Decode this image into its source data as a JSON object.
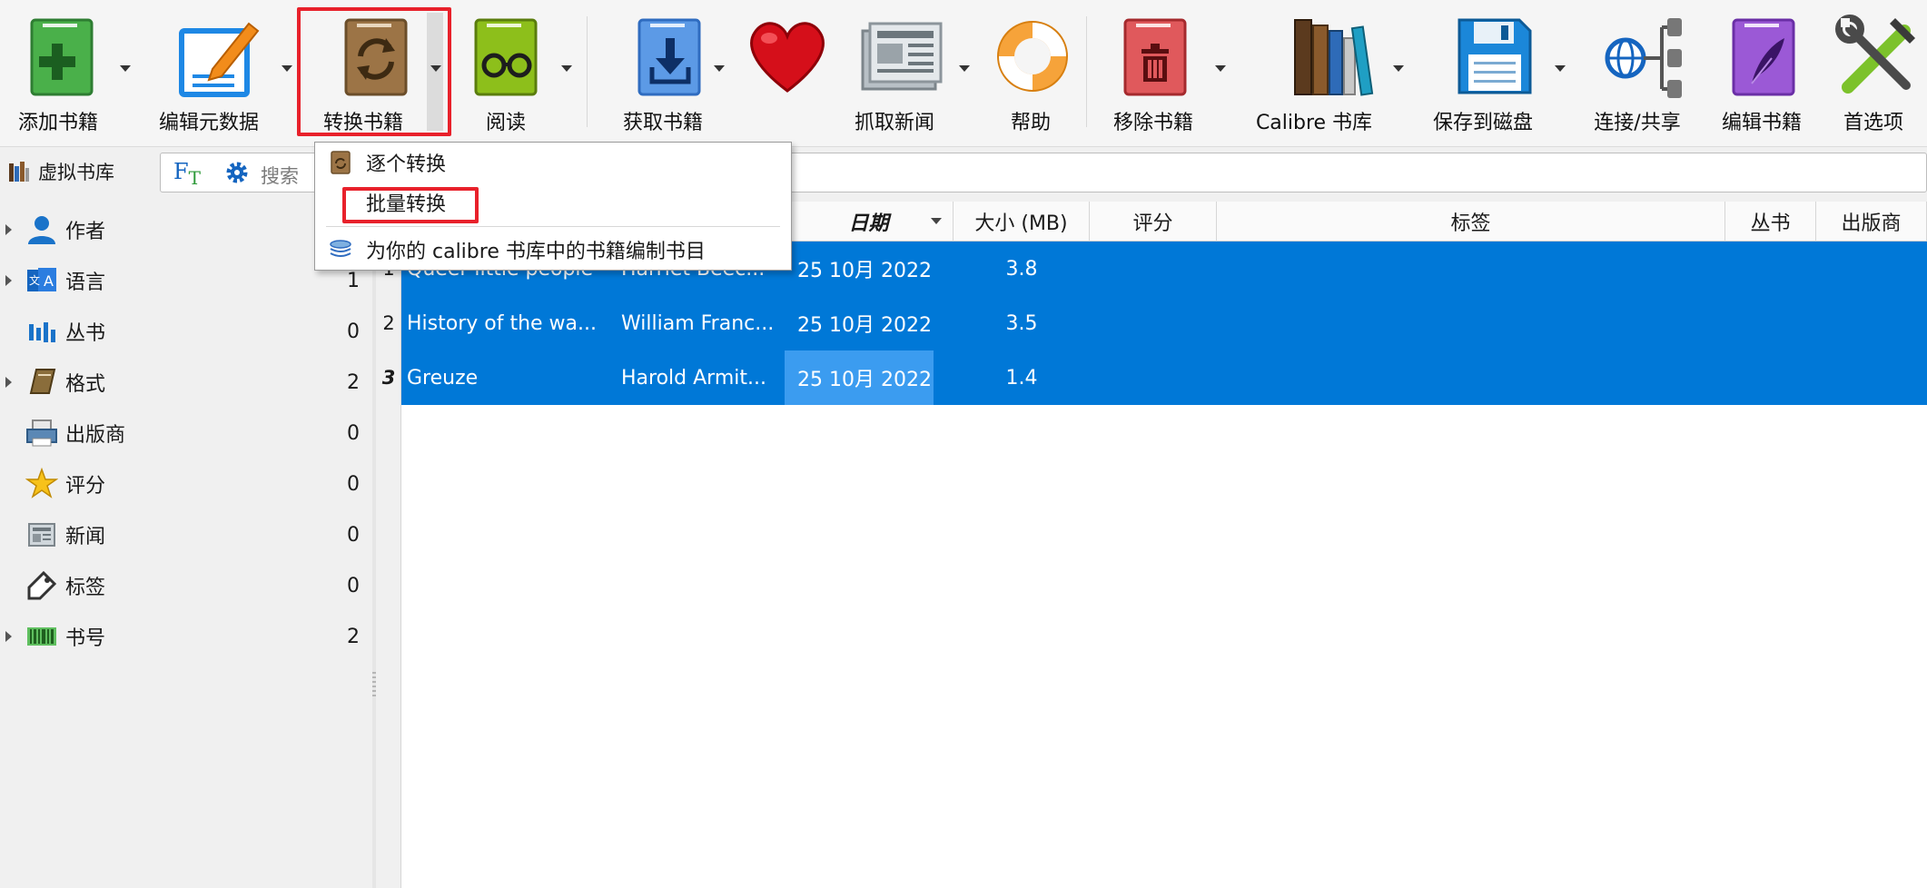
{
  "toolbar": {
    "buttons": [
      {
        "id": "add",
        "label": "添加书籍",
        "icon": "add-book-icon"
      },
      {
        "id": "edit-meta",
        "label": "编辑元数据",
        "icon": "edit-metadata-icon"
      },
      {
        "id": "convert",
        "label": "转换书籍",
        "icon": "convert-book-icon"
      },
      {
        "id": "view",
        "label": "阅读",
        "icon": "read-book-icon"
      },
      {
        "id": "get",
        "label": "获取书籍",
        "icon": "download-book-icon"
      },
      {
        "id": "donate",
        "label": "",
        "icon": "heart-icon"
      },
      {
        "id": "news",
        "label": "抓取新闻",
        "icon": "newspaper-icon"
      },
      {
        "id": "help",
        "label": "帮助",
        "icon": "lifebuoy-icon"
      },
      {
        "id": "remove",
        "label": "移除书籍",
        "icon": "trash-book-icon"
      },
      {
        "id": "library",
        "label": "Calibre 书库",
        "icon": "library-icon"
      },
      {
        "id": "save",
        "label": "保存到磁盘",
        "icon": "floppy-disk-icon"
      },
      {
        "id": "connect",
        "label": "连接/共享",
        "icon": "network-icon"
      },
      {
        "id": "edit-book",
        "label": "编辑书籍",
        "icon": "edit-book-icon"
      },
      {
        "id": "prefs",
        "label": "首选项",
        "icon": "tools-icon"
      }
    ]
  },
  "search": {
    "virtual_library": "虚拟书库",
    "ft_label": "FT",
    "placeholder": "搜索"
  },
  "menu": {
    "items": [
      {
        "label": "逐个转换"
      },
      {
        "label": "批量转换"
      },
      {
        "label": "为你的 calibre 书库中的书籍编制书目"
      }
    ]
  },
  "tag_browser": {
    "items": [
      {
        "name": "作者",
        "count": "",
        "expandable": true,
        "icon": "person-icon"
      },
      {
        "name": "语言",
        "count": "1",
        "expandable": true,
        "icon": "language-icon"
      },
      {
        "name": "丛书",
        "count": "0",
        "expandable": false,
        "icon": "series-icon"
      },
      {
        "name": "格式",
        "count": "2",
        "expandable": true,
        "icon": "format-book-icon"
      },
      {
        "name": "出版商",
        "count": "0",
        "expandable": false,
        "icon": "publisher-icon"
      },
      {
        "name": "评分",
        "count": "0",
        "expandable": false,
        "icon": "star-icon"
      },
      {
        "name": "新闻",
        "count": "0",
        "expandable": false,
        "icon": "news-icon"
      },
      {
        "name": "标签",
        "count": "0",
        "expandable": false,
        "icon": "tag-icon"
      },
      {
        "name": "书号",
        "count": "2",
        "expandable": true,
        "icon": "barcode-icon"
      }
    ]
  },
  "book_table": {
    "columns": {
      "date": "日期",
      "size": "大小 (MB)",
      "rating": "评分",
      "tags": "标签",
      "series": "丛书",
      "publisher": "出版商"
    },
    "rows": [
      {
        "num": "1",
        "title": "Queer little people",
        "author": "Harriet Beec...",
        "date": "25 10月 2022",
        "size": "3.8"
      },
      {
        "num": "2",
        "title": "History of the wa...",
        "author": "William Franc...",
        "date": "25 10月 2022",
        "size": "3.5"
      },
      {
        "num": "3",
        "title": "Greuze",
        "author": "Harold Armit...",
        "date": "25 10月 2022",
        "size": "1.4"
      }
    ]
  },
  "colors": {
    "selection": "#0078d7",
    "current_cell": "#3b9cf0",
    "highlight_box": "#e8212b"
  }
}
